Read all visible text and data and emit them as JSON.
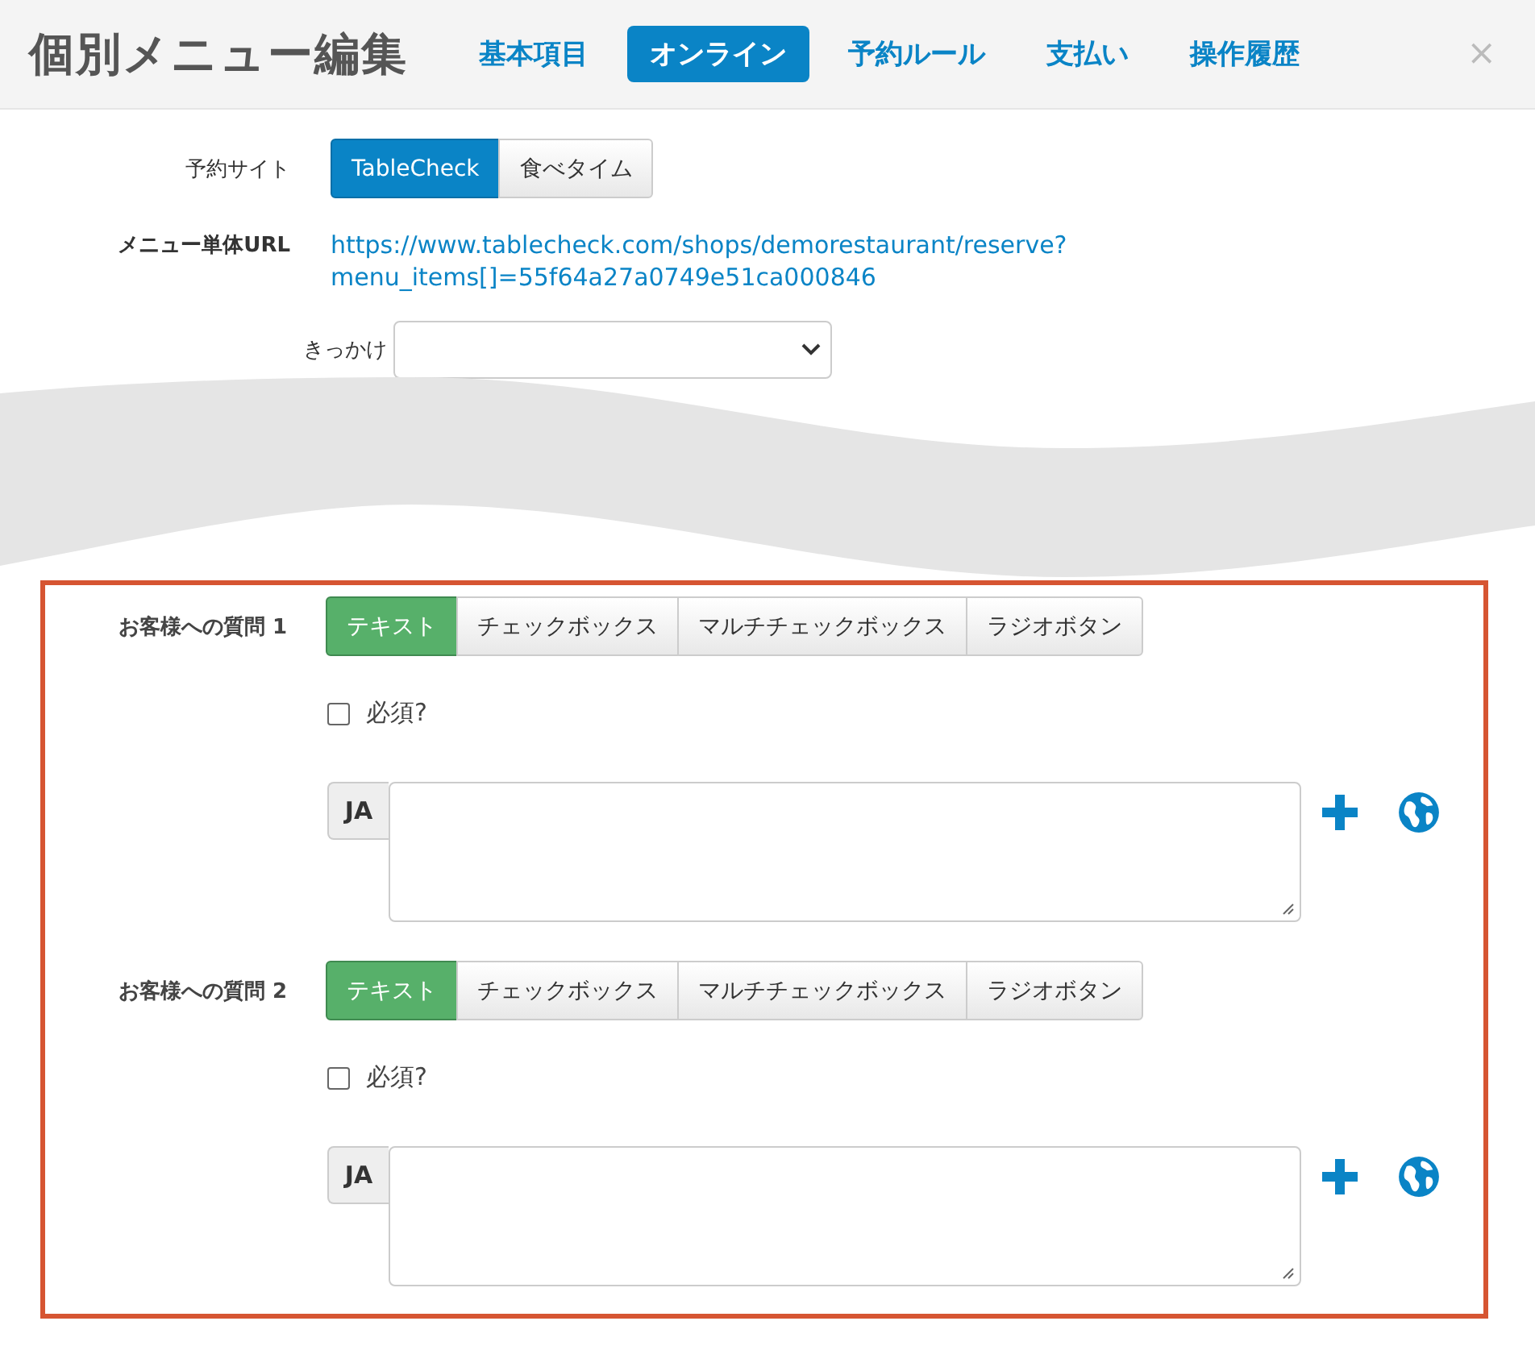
{
  "header": {
    "title": "個別メニュー編集",
    "close": "×",
    "tabs": [
      {
        "label": "基本項目",
        "selected": false
      },
      {
        "label": "オンライン",
        "selected": true
      },
      {
        "label": "予約ルール",
        "selected": false
      },
      {
        "label": "支払い",
        "selected": false
      },
      {
        "label": "操作履歴",
        "selected": false
      }
    ]
  },
  "site": {
    "label": "予約サイト",
    "options": [
      {
        "label": "TableCheck",
        "selected": true
      },
      {
        "label": "食べタイム",
        "selected": false
      }
    ]
  },
  "url": {
    "label": "メニュー単体URL",
    "lines": [
      "https://www.tablecheck.com/shops/demorestaurant/reserve?",
      "menu_items[]=55f64a27a0749e51ca000846"
    ]
  },
  "trigger": {
    "label": "きっかけ"
  },
  "questions": [
    {
      "label": "お客様への質問 1",
      "types": [
        {
          "label": "テキスト",
          "selected": true
        },
        {
          "label": "チェックボックス",
          "selected": false
        },
        {
          "label": "マルチチェックボックス",
          "selected": false
        },
        {
          "label": "ラジオボタン",
          "selected": false
        }
      ],
      "required": {
        "label": "必須?",
        "checked": false
      },
      "lang": "JA"
    },
    {
      "label": "お客様への質問 2",
      "types": [
        {
          "label": "テキスト",
          "selected": true
        },
        {
          "label": "チェックボックス",
          "selected": false
        },
        {
          "label": "マルチチェックボックス",
          "selected": false
        },
        {
          "label": "ラジオボタン",
          "selected": false
        }
      ],
      "required": {
        "label": "必須?",
        "checked": false
      },
      "lang": "JA"
    }
  ]
}
